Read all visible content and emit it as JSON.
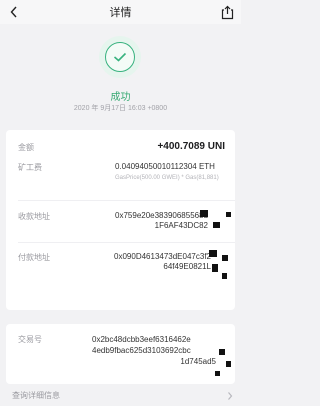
{
  "header": {
    "title": "详情"
  },
  "status": {
    "text": "成功",
    "time": "2020 年 9月17日 16:03 +0800"
  },
  "amount": {
    "label": "金额",
    "value": "+400.7089 UNI"
  },
  "fee": {
    "label": "矿工费",
    "value": "0.04094050010112304 ETH",
    "detail": "GasPrice(500.00 GWEI) * Gas(81,881)"
  },
  "receive": {
    "label": "收款地址",
    "line1": "0x759e20e38390685568d",
    "line2": "1F6AF43DC82"
  },
  "payer": {
    "label": "付款地址",
    "line1": "0x090D4613473dE047c3f2",
    "line2": "64f49E0821L"
  },
  "tx": {
    "label": "交易号",
    "line1": "0x2bc48dcbb3eef6316462e",
    "line2": "4edb9fbac625d3103692cbc",
    "line3": "1d745ad5"
  },
  "more": {
    "label": "查询详细信息"
  }
}
